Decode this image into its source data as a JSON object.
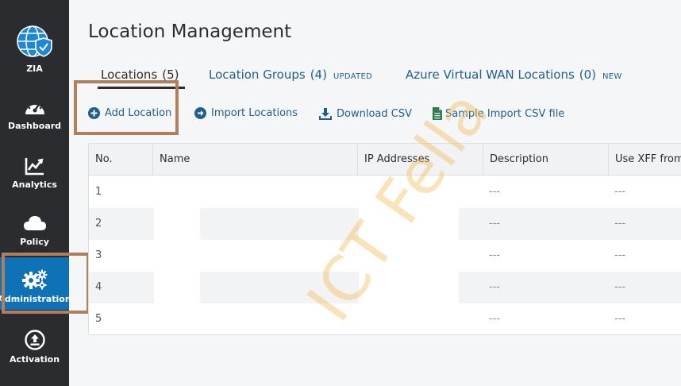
{
  "sidebar": {
    "items": [
      {
        "label": "ZIA",
        "icon": "globe-shield-icon"
      },
      {
        "label": "Dashboard",
        "icon": "gauge-icon"
      },
      {
        "label": "Analytics",
        "icon": "chart-line-icon"
      },
      {
        "label": "Policy",
        "icon": "cloud-icon"
      },
      {
        "label": "Administration",
        "icon": "gears-icon"
      },
      {
        "label": "Activation",
        "icon": "upload-icon"
      }
    ],
    "active_color": "#0f71b6"
  },
  "page": {
    "title": "Location Management"
  },
  "tabs": [
    {
      "label": "Locations",
      "count": "(5)",
      "badge": ""
    },
    {
      "label": "Location Groups",
      "count": "(4)",
      "badge": "UPDATED"
    },
    {
      "label": "Azure Virtual WAN Locations",
      "count": "(0)",
      "badge": "NEW"
    }
  ],
  "actions": {
    "add": "Add Location",
    "import": "Import Locations",
    "download": "Download CSV",
    "sample": "Sample Import CSV file"
  },
  "table": {
    "columns": [
      "No.",
      "Name",
      "IP Addresses",
      "Description",
      "Use XFF from"
    ],
    "rows": [
      {
        "no": "1",
        "description": "---",
        "xff": "---"
      },
      {
        "no": "2",
        "description": "---",
        "xff": "---"
      },
      {
        "no": "3",
        "description": "---",
        "xff": "---"
      },
      {
        "no": "4",
        "description": "---",
        "xff": "---"
      },
      {
        "no": "5",
        "description": "---",
        "xff": "---"
      }
    ]
  },
  "watermark": "ICT Fella"
}
